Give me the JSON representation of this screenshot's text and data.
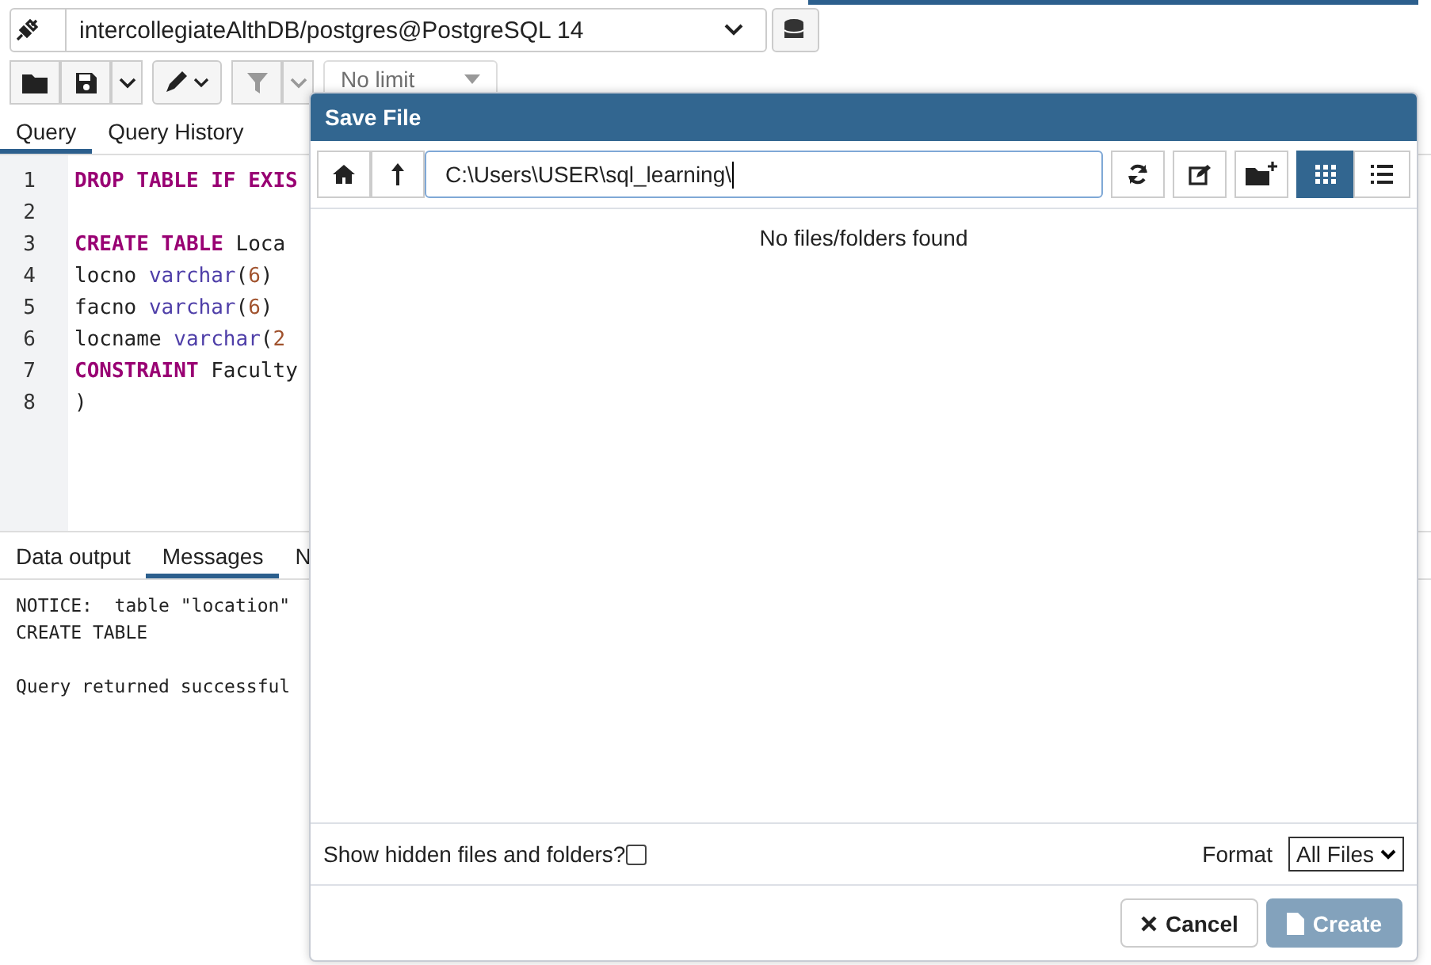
{
  "connection": {
    "label": "intercollegiateAlthDB/postgres@PostgreSQL 14"
  },
  "toolbar": {
    "limit": "No limit"
  },
  "query_tabs": [
    {
      "label": "Query",
      "selected": true
    },
    {
      "label": "Query History",
      "selected": false
    }
  ],
  "editor": {
    "lines": [
      {
        "number": "1",
        "segments": [
          {
            "kind": "keyword",
            "text": "DROP TABLE IF EXIS"
          }
        ]
      },
      {
        "number": "2"
      },
      {
        "number": "3",
        "segments": [
          {
            "kind": "keyword",
            "text": "CREATE TABLE"
          },
          {
            "kind": "plain",
            "text": " Loca"
          }
        ]
      },
      {
        "number": "4",
        "segments": [
          {
            "kind": "plain",
            "text": "locno "
          },
          {
            "kind": "type",
            "text": "varchar"
          },
          {
            "kind": "plain",
            "text": "("
          },
          {
            "kind": "number",
            "text": "6"
          },
          {
            "kind": "plain",
            "text": ")"
          }
        ]
      },
      {
        "number": "5",
        "segments": [
          {
            "kind": "plain",
            "text": "facno "
          },
          {
            "kind": "type",
            "text": "varchar"
          },
          {
            "kind": "plain",
            "text": "("
          },
          {
            "kind": "number",
            "text": "6"
          },
          {
            "kind": "plain",
            "text": ")"
          }
        ]
      },
      {
        "number": "6",
        "segments": [
          {
            "kind": "plain",
            "text": "locname "
          },
          {
            "kind": "type",
            "text": "varchar"
          },
          {
            "kind": "plain",
            "text": "("
          },
          {
            "kind": "number",
            "text": "2"
          }
        ]
      },
      {
        "number": "7",
        "segments": [
          {
            "kind": "keyword",
            "text": "CONSTRAINT"
          },
          {
            "kind": "plain",
            "text": " Faculty"
          }
        ]
      },
      {
        "number": "8",
        "segments": [
          {
            "kind": "plain",
            "text": ")"
          }
        ]
      }
    ]
  },
  "output_tabs": [
    {
      "label": "Data output",
      "selected": false
    },
    {
      "label": "Messages",
      "selected": true
    },
    {
      "label": "N",
      "selected": false
    }
  ],
  "messages": [
    {
      "lines": [
        "NOTICE:  table \"location\"",
        "CREATE TABLE"
      ]
    },
    {
      "lines": [
        "Query returned successful"
      ]
    }
  ],
  "dialog": {
    "title": "Save File",
    "path": "C:\\Users\\USER\\sql_learning\\",
    "views": [
      {
        "kind": "grid",
        "selected": true
      },
      {
        "kind": "list",
        "selected": false
      }
    ],
    "empty_text": "No files/folders found",
    "show_hidden": {
      "label": "Show hidden files and folders?",
      "checked": false
    },
    "format": {
      "label": "Format",
      "value": "All Files"
    },
    "buttons": [
      {
        "kind": "cancel",
        "label": "Cancel",
        "disabled": false
      },
      {
        "kind": "create",
        "label": "Create",
        "disabled": true
      }
    ]
  }
}
